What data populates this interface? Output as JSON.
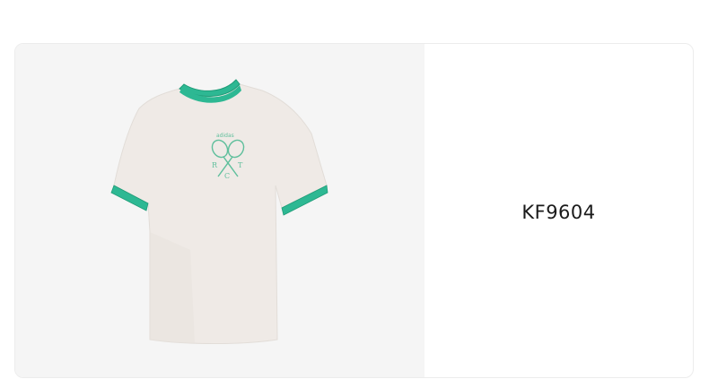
{
  "product": {
    "code": "KF9604",
    "image_alt": "Off-white tennis t-shirt with green ringer trim",
    "brand_mark": "adidas",
    "crest_letters": [
      "R",
      "T",
      "C"
    ]
  },
  "colors": {
    "shirt": "#efeae6",
    "trim": "#2db893",
    "trim_dark": "#1f9c78",
    "emblem": "#5fbf9c",
    "image_bg": "#f5f5f5"
  }
}
